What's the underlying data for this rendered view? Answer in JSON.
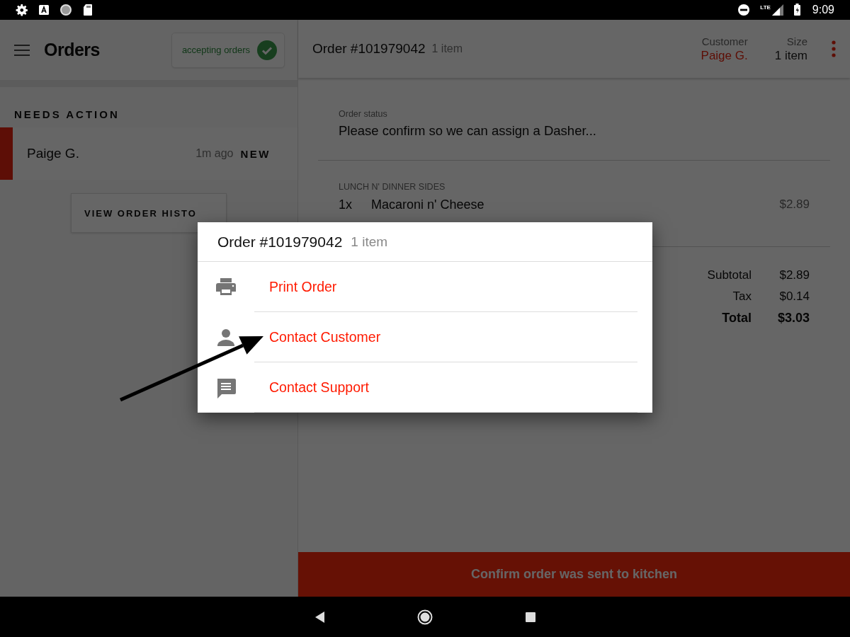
{
  "status_bar": {
    "signal_label": "LTE",
    "time": "9:09"
  },
  "sidebar": {
    "title": "Orders",
    "accepting": {
      "label": "accepting orders",
      "on": true
    },
    "section": "NEEDS ACTION",
    "orders": [
      {
        "customer": "Paige G.",
        "age": "1m ago",
        "badge": "NEW",
        "selected": true
      }
    ],
    "history_button": "VIEW ORDER HISTO"
  },
  "order": {
    "title": "Order #101979042",
    "count": "1 item",
    "customer_label": "Customer",
    "customer": "Paige G.",
    "size_label": "Size",
    "size": "1 item",
    "status_label": "Order status",
    "status": "Please confirm so we can assign a Dasher...",
    "category": "LUNCH N' DINNER SIDES",
    "items": [
      {
        "qty": "1x",
        "name": "Macaroni n' Cheese",
        "price": "$2.89"
      }
    ],
    "totals": [
      {
        "label": "Subtotal",
        "value": "$2.89",
        "kind": "normal"
      },
      {
        "label": "Tax",
        "value": "$0.14",
        "kind": "normal"
      },
      {
        "label": "Total",
        "value": "$3.03",
        "kind": "total"
      }
    ],
    "confirm_button": "Confirm order was sent to kitchen"
  },
  "dialog": {
    "title": "Order #101979042",
    "count": "1 item",
    "actions": [
      {
        "kind": "print",
        "label": "Print Order"
      },
      {
        "kind": "person",
        "label": "Contact Customer"
      },
      {
        "kind": "chat",
        "label": "Contact Support"
      }
    ]
  },
  "annotation": {
    "kind": "arrow"
  }
}
